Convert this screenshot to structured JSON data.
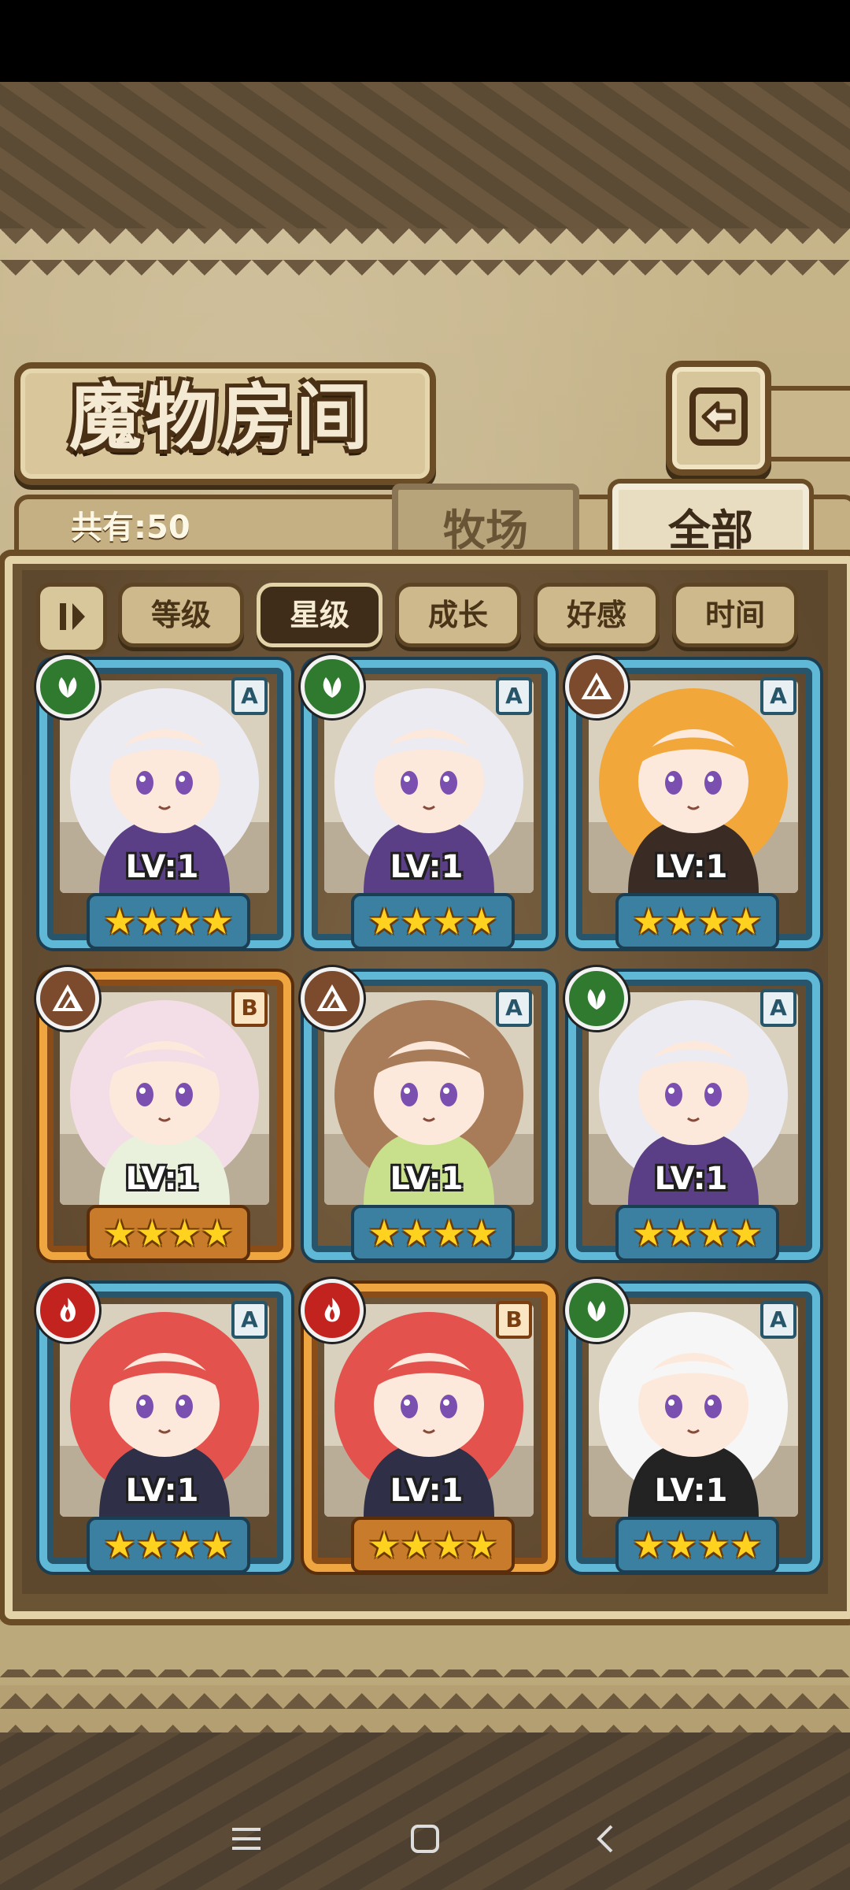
{
  "header": {
    "title": "魔物房间",
    "back_icon": "return-arrow-icon"
  },
  "summary": {
    "count_label": "共有:50"
  },
  "tabs": [
    {
      "label": "牧场",
      "active": false
    },
    {
      "label": "全部",
      "active": true
    }
  ],
  "filters": {
    "sort_icon": "sort-order-icon",
    "items": [
      {
        "label": "等级",
        "active": false
      },
      {
        "label": "星级",
        "active": true
      },
      {
        "label": "成长",
        "active": false
      },
      {
        "label": "好感",
        "active": false
      },
      {
        "label": "时间",
        "active": false
      }
    ]
  },
  "monsters": [
    {
      "rank": "A",
      "element": "grass",
      "level": "LV:1",
      "stars": 4,
      "hair": "#ecebf2",
      "outfit": "#5b3f86"
    },
    {
      "rank": "A",
      "element": "grass",
      "level": "LV:1",
      "stars": 4,
      "hair": "#ecebf2",
      "outfit": "#5b3f86"
    },
    {
      "rank": "A",
      "element": "rock",
      "level": "LV:1",
      "stars": 4,
      "hair": "#f2a73a",
      "outfit": "#3a2b25"
    },
    {
      "rank": "B",
      "element": "rock",
      "level": "LV:1",
      "stars": 4,
      "hair": "#f3dde6",
      "outfit": "#e9f1dd"
    },
    {
      "rank": "A",
      "element": "rock",
      "level": "LV:1",
      "stars": 4,
      "hair": "#a87c58",
      "outfit": "#c8e08c"
    },
    {
      "rank": "A",
      "element": "grass",
      "level": "LV:1",
      "stars": 4,
      "hair": "#ecebf2",
      "outfit": "#5b3f86"
    },
    {
      "rank": "A",
      "element": "fire",
      "level": "LV:1",
      "stars": 4,
      "hair": "#e4524e",
      "outfit": "#2f2f48"
    },
    {
      "rank": "B",
      "element": "fire",
      "level": "LV:1",
      "stars": 4,
      "hair": "#e4524e",
      "outfit": "#2f2f48"
    },
    {
      "rank": "A",
      "element": "grass",
      "level": "LV:1",
      "stars": 4,
      "hair": "#f6f6f6",
      "outfit": "#232323"
    }
  ],
  "navbar": {
    "items": [
      "menu-icon",
      "home-square-icon",
      "back-chevron-icon"
    ]
  }
}
